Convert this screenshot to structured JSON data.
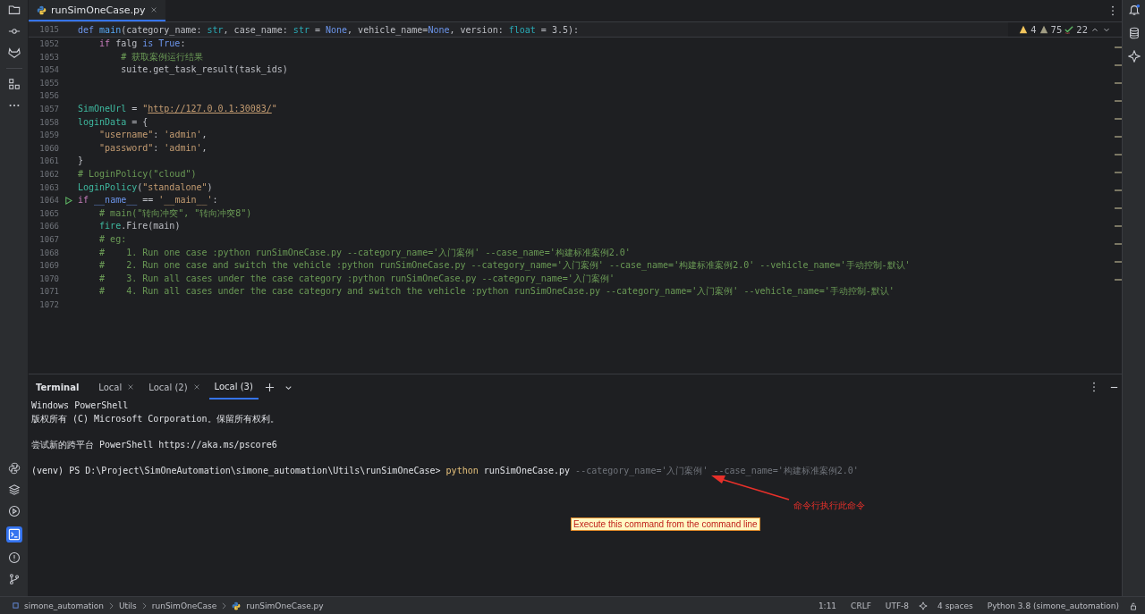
{
  "editor_tabs": [
    {
      "label": "runSimOneCase.py",
      "selected": true
    }
  ],
  "inspections": {
    "warnings": "4",
    "weak_warnings": "75",
    "typos": "22"
  },
  "sticky_line": {
    "number": "1015",
    "tokens": [
      {
        "text": "def ",
        "kind": "kw"
      },
      {
        "text": "main",
        "kind": "fn"
      },
      {
        "text": "(category_name: ",
        "kind": "plain"
      },
      {
        "text": "str",
        "kind": "type"
      },
      {
        "text": ", case_name: ",
        "kind": "plain"
      },
      {
        "text": "str",
        "kind": "type"
      },
      {
        "text": " = ",
        "kind": "plain"
      },
      {
        "text": "None",
        "kind": "kw"
      },
      {
        "text": ", vehicle_name=",
        "kind": "plain"
      },
      {
        "text": "None",
        "kind": "kw"
      },
      {
        "text": ", version: ",
        "kind": "plain"
      },
      {
        "text": "float",
        "kind": "type"
      },
      {
        "text": " = 3.5):",
        "kind": "plain"
      }
    ]
  },
  "code_lines": [
    {
      "number": "1052",
      "run": false,
      "tokens": [
        {
          "text": "    if",
          "kind": "ctrl"
        },
        {
          "text": " falg ",
          "kind": "plain"
        },
        {
          "text": "is True",
          "kind": "kw"
        },
        {
          "text": ":",
          "kind": "plain"
        }
      ]
    },
    {
      "number": "1053",
      "run": false,
      "tokens": [
        {
          "text": "        # 获取案例运行结果",
          "kind": "com"
        }
      ]
    },
    {
      "number": "1054",
      "run": false,
      "tokens": [
        {
          "text": "        suite.get_task_result(task_ids)",
          "kind": "plain"
        }
      ]
    },
    {
      "number": "1055",
      "run": false
    },
    {
      "number": "1056",
      "run": false
    },
    {
      "number": "1057",
      "run": false,
      "tokens": [
        {
          "text": "SimOneUrl",
          "kind": "var"
        },
        {
          "text": " = ",
          "kind": "plain"
        },
        {
          "text": "\"",
          "kind": "str"
        },
        {
          "text": "http://127.0.0.1:30083/",
          "kind": "link"
        },
        {
          "text": "\"",
          "kind": "str"
        }
      ]
    },
    {
      "number": "1058",
      "run": false,
      "tokens": [
        {
          "text": "loginData",
          "kind": "var"
        },
        {
          "text": " = {",
          "kind": "plain"
        }
      ]
    },
    {
      "number": "1059",
      "run": false,
      "tokens": [
        {
          "text": "    \"username\"",
          "kind": "str"
        },
        {
          "text": ": ",
          "kind": "plain"
        },
        {
          "text": "'admin'",
          "kind": "str"
        },
        {
          "text": ",",
          "kind": "plain"
        }
      ]
    },
    {
      "number": "1060",
      "run": false,
      "tokens": [
        {
          "text": "    \"password\"",
          "kind": "str"
        },
        {
          "text": ": ",
          "kind": "plain"
        },
        {
          "text": "'admin'",
          "kind": "str"
        },
        {
          "text": ",",
          "kind": "plain"
        }
      ]
    },
    {
      "number": "1061",
      "run": false,
      "tokens": [
        {
          "text": "}",
          "kind": "plain"
        }
      ]
    },
    {
      "number": "1062",
      "run": false,
      "tokens": [
        {
          "text": "# LoginPolicy(\"cloud\")",
          "kind": "com"
        }
      ]
    },
    {
      "number": "1063",
      "run": false,
      "tokens": [
        {
          "text": "LoginPolicy",
          "kind": "var"
        },
        {
          "text": "(",
          "kind": "plain"
        },
        {
          "text": "\"standalone\"",
          "kind": "str"
        },
        {
          "text": ")",
          "kind": "plain"
        }
      ]
    },
    {
      "number": "1064",
      "run": true,
      "tokens": [
        {
          "text": "if",
          "kind": "ctrl"
        },
        {
          "text": " __name__",
          "kind": "kw"
        },
        {
          "text": " == ",
          "kind": "plain"
        },
        {
          "text": "'__main__'",
          "kind": "str"
        },
        {
          "text": ":",
          "kind": "plain"
        }
      ]
    },
    {
      "number": "1065",
      "run": false,
      "tokens": [
        {
          "text": "    # main(\"转向冲突\", \"转向冲突8\")",
          "kind": "com"
        }
      ]
    },
    {
      "number": "1066",
      "run": false,
      "tokens": [
        {
          "text": "    fire",
          "kind": "var"
        },
        {
          "text": ".Fire(main)",
          "kind": "plain"
        }
      ]
    },
    {
      "number": "1067",
      "run": false,
      "tokens": [
        {
          "text": "    # eg:",
          "kind": "com"
        }
      ]
    },
    {
      "number": "1068",
      "run": false,
      "tokens": [
        {
          "text": "    #    1. Run one case :python runSimOneCase.py --category_name='入门案例' --case_name='构建标准案例2.0'",
          "kind": "com"
        }
      ]
    },
    {
      "number": "1069",
      "run": false,
      "tokens": [
        {
          "text": "    #    2. Run one case and switch the vehicle :python runSimOneCase.py --category_name='入门案例' --case_name='构建标准案例2.0' --vehicle_name='手动控制-默认'",
          "kind": "com"
        }
      ]
    },
    {
      "number": "1070",
      "run": false,
      "tokens": [
        {
          "text": "    #    3. Run all cases under the case category :python runSimOneCase.py --category_name='入门案例'",
          "kind": "com"
        }
      ]
    },
    {
      "number": "1071",
      "run": false,
      "tokens": [
        {
          "text": "    #    4. Run all cases under the case category and switch the vehicle :python runSimOneCase.py --category_name='入门案例' --vehicle_name='手动控制-默认'",
          "kind": "com"
        }
      ]
    },
    {
      "number": "1072",
      "run": false
    }
  ],
  "terminal": {
    "title": "Terminal",
    "tabs": [
      {
        "label": "Local",
        "selected": false
      },
      {
        "label": "Local (2)",
        "selected": false
      },
      {
        "label": "Local (3)",
        "selected": true
      }
    ],
    "paragraphs": [
      [
        "Windows PowerShell",
        "版权所有 (C) Microsoft Corporation。保留所有权利。"
      ],
      [
        "尝试新的跨平台 PowerShell https://aka.ms/pscore6"
      ]
    ],
    "prompt": "(venv) PS D:\\Project\\SimOneAutomation\\simone_automation\\Utils\\runSimOneCase>",
    "command": "python",
    "arguments": "runSimOneCase.py",
    "suggestion": "--category_name='入门案例' --case_name='构建标准案例2.0'"
  },
  "annotation": {
    "note": "命令行执行此命令",
    "caption": "Execute this command from the command line"
  },
  "status_bar": {
    "breadcrumbs": [
      "simone_automation",
      "Utils",
      "runSimOneCase",
      "runSimOneCase.py"
    ],
    "items": [
      "1:11",
      "CRLF",
      "UTF-8",
      "4 spaces",
      "Python 3.8 (simone_automation)"
    ]
  }
}
